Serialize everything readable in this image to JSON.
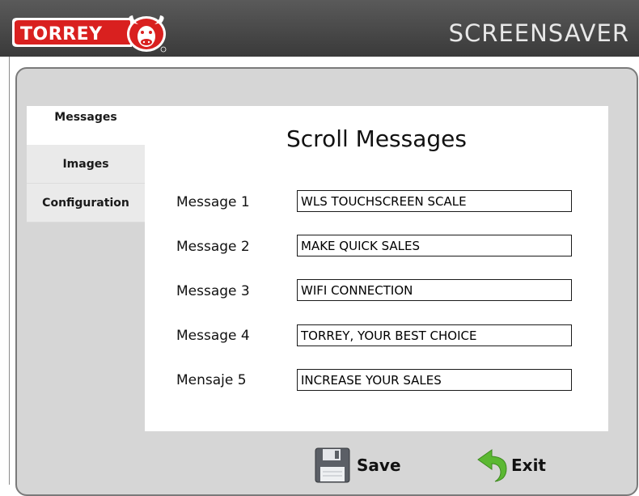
{
  "header": {
    "brand": "TORREY",
    "title": "SCREENSAVER",
    "logo_color": "#d9201f"
  },
  "tabs": [
    {
      "label": "Messages",
      "active": true
    },
    {
      "label": "Images",
      "active": false
    },
    {
      "label": "Configuration",
      "active": false
    }
  ],
  "panel": {
    "title": "Scroll Messages",
    "rows": [
      {
        "label": "Message 1",
        "value": "WLS TOUCHSCREEN SCALE"
      },
      {
        "label": "Message 2",
        "value": "MAKE QUICK SALES"
      },
      {
        "label": "Message 3",
        "value": "WIFI CONNECTION"
      },
      {
        "label": "Message 4",
        "value": "TORREY, YOUR BEST CHOICE"
      },
      {
        "label": "Mensaje 5",
        "value": "INCREASE YOUR SALES"
      }
    ]
  },
  "buttons": {
    "save_label": "Save",
    "exit_label": "Exit",
    "save_icon": "floppy-disk-icon",
    "exit_icon": "back-arrow-icon",
    "exit_icon_color": "#5bb832"
  }
}
